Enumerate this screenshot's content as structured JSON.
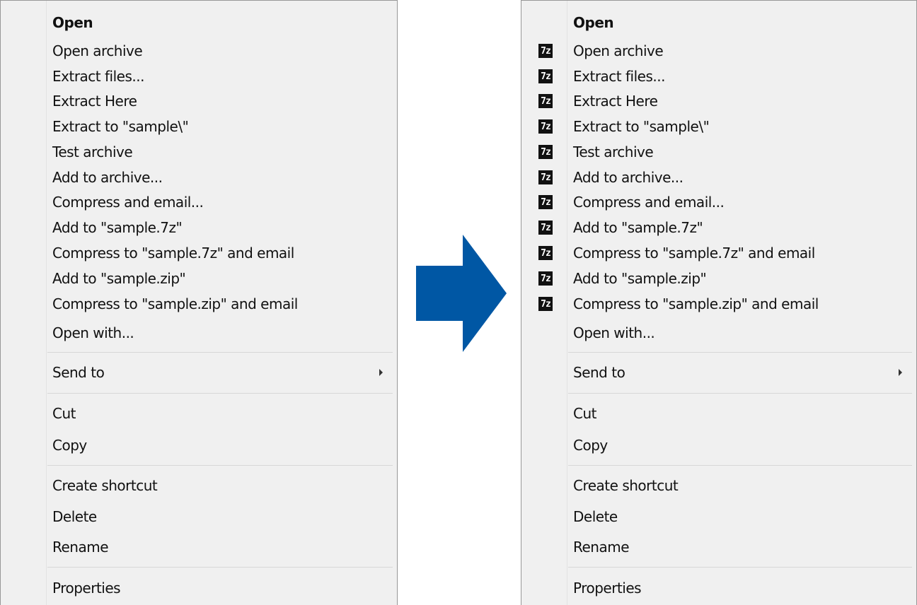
{
  "left_menu": {
    "items": [
      "Open",
      "Open archive",
      "Extract files...",
      "Extract Here",
      "Extract to \"sample\\\"",
      "Test archive",
      "Add to archive...",
      "Compress and email...",
      "Add to \"sample.7z\"",
      "Compress to \"sample.7z\" and email",
      "Add to \"sample.zip\"",
      "Compress to \"sample.zip\" and email",
      "Open with...",
      "Send to",
      "Cut",
      "Copy",
      "Create shortcut",
      "Delete",
      "Rename",
      "Properties"
    ]
  },
  "right_menu": {
    "items": [
      "Open",
      "Open archive",
      "Extract files...",
      "Extract Here",
      "Extract to \"sample\\\"",
      "Test archive",
      "Add to archive...",
      "Compress and email...",
      "Add to \"sample.7z\"",
      "Compress to \"sample.7z\" and email",
      "Add to \"sample.zip\"",
      "Compress to \"sample.zip\" and email",
      "Open with...",
      "Send to",
      "Cut",
      "Copy",
      "Create shortcut",
      "Delete",
      "Rename",
      "Properties"
    ],
    "icon_text": "7z",
    "icon_name": "7zip-icon"
  },
  "arrow": {
    "icon_name": "right-arrow-icon",
    "color": "#0057a4"
  },
  "colors": {
    "menu_background": "#f0f0f0",
    "menu_border": "#979797",
    "separator": "#d7d7d7",
    "text": "#111111"
  }
}
